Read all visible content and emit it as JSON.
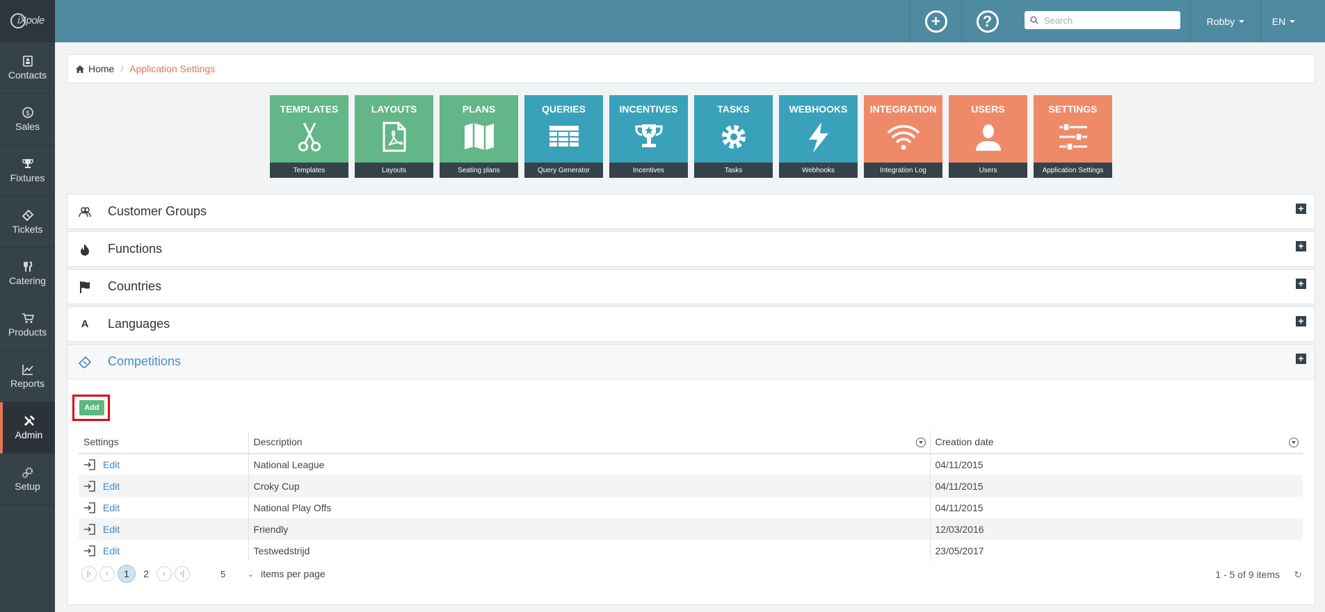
{
  "brand": {
    "logo_text": "iXpole"
  },
  "sidebar": {
    "items": [
      {
        "label": "Contacts",
        "icon": "contacts-icon"
      },
      {
        "label": "Sales",
        "icon": "dollar-icon"
      },
      {
        "label": "Fixtures",
        "icon": "trophy-icon"
      },
      {
        "label": "Tickets",
        "icon": "ticket-icon"
      },
      {
        "label": "Catering",
        "icon": "cutlery-icon"
      },
      {
        "label": "Products",
        "icon": "cart-icon"
      },
      {
        "label": "Reports",
        "icon": "chart-icon"
      },
      {
        "label": "Admin",
        "icon": "tools-icon",
        "active": true
      },
      {
        "label": "Setup",
        "icon": "gears-icon"
      }
    ]
  },
  "topbar": {
    "search_placeholder": "Search",
    "user": "Robby",
    "language": "EN"
  },
  "breadcrumb": {
    "home": "Home",
    "current": "Application Settings"
  },
  "tiles": [
    {
      "title": "TEMPLATES",
      "footer": "Templates",
      "color": "#63b687",
      "icon": "scissors-icon"
    },
    {
      "title": "LAYOUTS",
      "footer": "Layouts",
      "color": "#63b687",
      "icon": "pdf-icon"
    },
    {
      "title": "PLANS",
      "footer": "Seating plans",
      "color": "#63b687",
      "icon": "map-icon"
    },
    {
      "title": "QUERIES",
      "footer": "Query Generator",
      "color": "#3aa1bb",
      "icon": "table-icon"
    },
    {
      "title": "INCENTIVES",
      "footer": "Incentives",
      "color": "#3aa1bb",
      "icon": "trophy-icon"
    },
    {
      "title": "TASKS",
      "footer": "Tasks",
      "color": "#3aa1bb",
      "icon": "gear-icon"
    },
    {
      "title": "WEBHOOKS",
      "footer": "Webhooks",
      "color": "#3aa1bb",
      "icon": "lightning-icon"
    },
    {
      "title": "INTEGRATION",
      "footer": "Integration Log",
      "color": "#ef8a69",
      "icon": "wifi-icon"
    },
    {
      "title": "USERS",
      "footer": "Users",
      "color": "#ef8a69",
      "icon": "user-icon"
    },
    {
      "title": "SETTINGS",
      "footer": "Application Settings",
      "color": "#ef8a69",
      "icon": "sliders-icon"
    }
  ],
  "panels": {
    "customer_groups": "Customer Groups",
    "functions": "Functions",
    "countries": "Countries",
    "languages": "Languages",
    "competitions": "Competitions",
    "languages_icon_letter": "A"
  },
  "competitions": {
    "add_label": "Add",
    "columns": [
      "Settings",
      "Description",
      "Creation date"
    ],
    "edit_label": "Edit",
    "rows": [
      {
        "description": "National League",
        "created": "04/11/2015"
      },
      {
        "description": "Croky Cup",
        "created": "04/11/2015"
      },
      {
        "description": "National Play Offs",
        "created": "04/11/2015"
      },
      {
        "description": "Friendly",
        "created": "12/03/2016"
      },
      {
        "description": "Testwedstrijd",
        "created": "23/05/2017"
      }
    ],
    "pager": {
      "pages": [
        "1",
        "2"
      ],
      "current_page": "1",
      "page_size": "5",
      "per_page_label": "items per page",
      "info": "1 - 5 of 9 items"
    }
  }
}
